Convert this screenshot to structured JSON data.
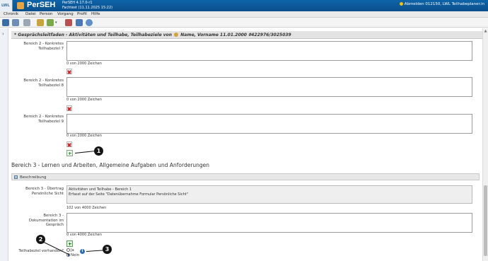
{
  "titlebar": {
    "logo_text": "LWL",
    "app_name": "PerSEH",
    "version_line1": "PerSEH 4.17.0-r1",
    "version_line2": "Fachtest (11.11.2025 15:22)",
    "logout_text": "Abmelden 012150, LWL Teilhabeplaner.in"
  },
  "menu": {
    "chronik": "Chronik",
    "datei": "Datei",
    "person": "Person",
    "vorgang": "Vorgang",
    "profil": "Profil",
    "hilfe": "Hilfe"
  },
  "section": {
    "title_prefix": "* Gesprächsleitfaden - Aktivitäten und Teilhabe, Teilhabeziele von",
    "title_suffix": "Name, Vorname 11.01.2000 #422976/3025039"
  },
  "fields": [
    {
      "label": "Bereich 2 - Konkretes Teilhabeziel 7",
      "counter": "0 von 2000 Zeichen"
    },
    {
      "label": "Bereich 2 - Konkretes Teilhabeziel 8",
      "counter": "0 von 2000 Zeichen"
    },
    {
      "label": "Bereich 2 - Konkretes Teilhabeziel 9",
      "counter": "0 von 2000 Zeichen"
    }
  ],
  "bereich3": {
    "title": "Bereich 3 - Lernen und Arbeiten, Allgemeine Aufgaben und Anforderungen",
    "collapse_label": "Beschreibung",
    "uebertrag_label": "Bereich 3 - Übertrag Persönliche Sicht",
    "uebertrag_text": "Aktivitäten und Teilhabe - Bereich 1\nErfasst auf der Seite \"Datenübernahme Formular Persönliche Sicht\"",
    "uebertrag_counter": "102 von 4000 Zeichen",
    "doku_label": "Bereich 3 - Dokumentation im Gespräch",
    "doku_counter": "0 von 4000 Zeichen",
    "teilhabeziel_label": "Teilhabeziel vorhanden?",
    "radio_ja": "Ja",
    "radio_nein": "Nein",
    "radio_selected": "Nein"
  },
  "callouts": [
    "1",
    "2",
    "3"
  ],
  "icons": {
    "add": "plus-icon",
    "delete": "red-x-icon",
    "info": "info-icon"
  },
  "colors": {
    "titlebar": "#0b5a9c",
    "accent": "#2c6fc1",
    "delete": "#d02020",
    "add": "#3e9e3e"
  }
}
